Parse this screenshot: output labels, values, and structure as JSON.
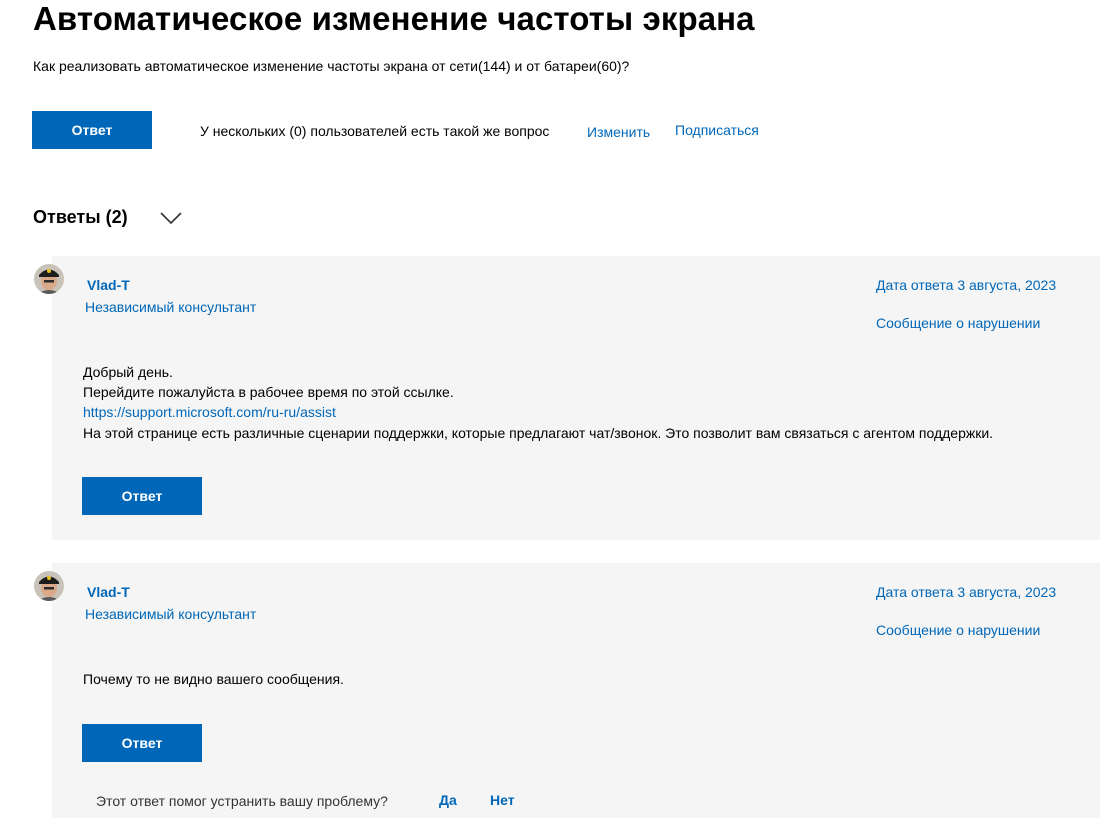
{
  "question": {
    "title": "Автоматическое изменение частоты экрана",
    "body": "Как реализовать автоматическое изменение частоты экрана от сети(144) и от батареи(60)?",
    "reply_label": "Ответ",
    "same_question_text": "У нескольких (0) пользователей есть такой же вопрос",
    "edit_label": "Изменить",
    "subscribe_label": "Подписаться"
  },
  "answers_section": {
    "heading": "Ответы (2)"
  },
  "answers": [
    {
      "author": "Vlad-T",
      "role": "Независимый консультант",
      "date": "Дата ответа 3 августа, 2023",
      "report_label": "Сообщение о нарушении",
      "line1": "Добрый день.",
      "line2": "Перейдите пожалуйста в рабочее время по этой ссылке.",
      "link": "https://support.microsoft.com/ru-ru/assist",
      "line3": "На этой странице есть различные сценарии поддержки, которые предлагают чат/звонок. Это позволит вам связаться с агентом поддержки.",
      "reply_label": "Ответ"
    },
    {
      "author": "Vlad-T",
      "role": "Независимый консультант",
      "date": "Дата ответа 3 августа, 2023",
      "report_label": "Сообщение о нарушении",
      "line1": "Почему то не видно вашего сообщения.",
      "reply_label": "Ответ"
    }
  ],
  "feedback": {
    "question": "Этот ответ помог устранить вашу проблему?",
    "yes_label": "Да",
    "no_label": "Нет"
  },
  "colors": {
    "accent": "#0067b8",
    "card_background": "#f5f5f5"
  },
  "icons": {
    "expand": "chevron-down-icon",
    "avatar": "user-avatar-icon"
  }
}
